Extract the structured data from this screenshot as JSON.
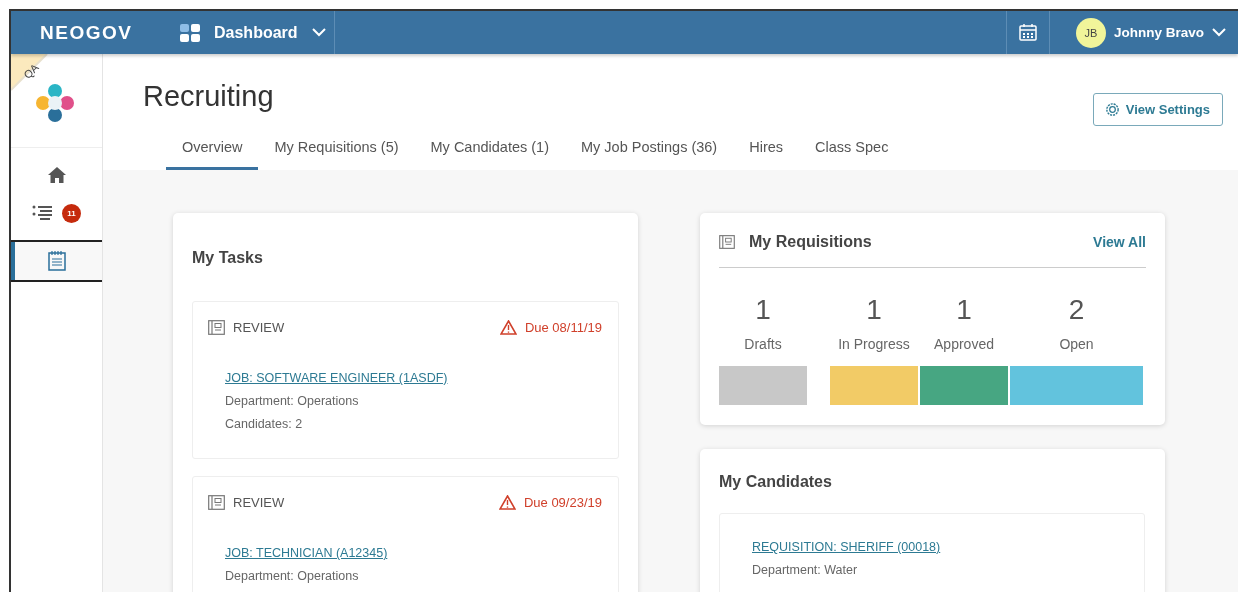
{
  "topbar": {
    "brand": "NEOGOV",
    "app_menu": "Dashboard",
    "user": {
      "initials": "JB",
      "name": "Johnny Bravo"
    }
  },
  "sidebar": {
    "env_tag": "QA",
    "items": [
      {
        "kind": "home",
        "selected": false
      },
      {
        "kind": "list",
        "selected": false,
        "badge": "11"
      },
      {
        "kind": "notepad",
        "selected": true
      }
    ]
  },
  "page": {
    "title": "Recruiting",
    "settings_button": "View Settings"
  },
  "tabs": [
    {
      "label": "Overview",
      "selected": true
    },
    {
      "label": "My Requisitions (5)",
      "selected": false
    },
    {
      "label": "My Candidates (1)",
      "selected": false
    },
    {
      "label": "My Job Postings (36)",
      "selected": false
    },
    {
      "label": "Hires",
      "selected": false
    },
    {
      "label": "Class Spec",
      "selected": false
    }
  ],
  "my_tasks": {
    "title": "My Tasks",
    "tasks": [
      {
        "type": "REVIEW",
        "due": "Due 08/11/19",
        "link": "JOB: SOFTWARE ENGINEER (1ASDF)",
        "details": [
          "Department: Operations",
          "Candidates: 2"
        ]
      },
      {
        "type": "REVIEW",
        "due": "Due 09/23/19",
        "link": "JOB: TECHNICIAN (A12345)",
        "details": [
          "Department: Operations"
        ]
      }
    ]
  },
  "my_requisitions": {
    "title": "My Requisitions",
    "view_all": "View All",
    "statuses": [
      {
        "count": "1",
        "label": "Drafts",
        "color": "#c8c8c8"
      },
      {
        "count": "1",
        "label": "In Progress",
        "color": "#f2cb66"
      },
      {
        "count": "1",
        "label": "Approved",
        "color": "#47a682"
      },
      {
        "count": "2",
        "label": "Open",
        "color": "#62c3dd"
      }
    ]
  },
  "my_candidates": {
    "title": "My Candidates",
    "items": [
      {
        "link": "REQUISITION: SHERIFF (00018)",
        "details": [
          "Department: Water"
        ]
      }
    ]
  }
}
